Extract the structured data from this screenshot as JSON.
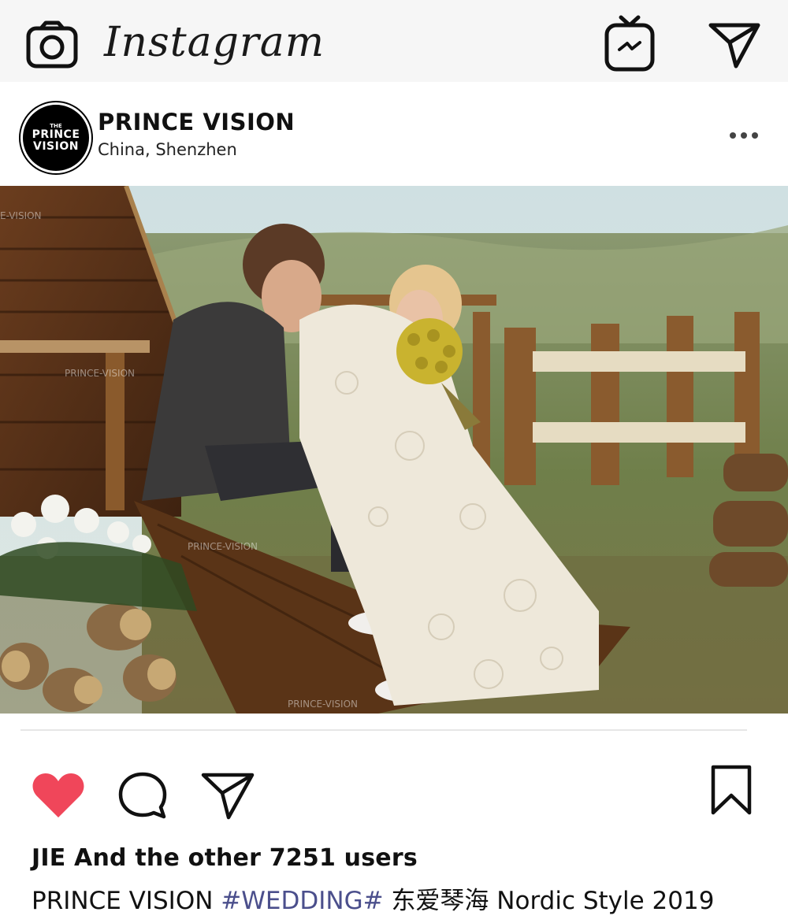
{
  "app": {
    "title": "Instagram"
  },
  "post": {
    "username": "PRINCE VISION",
    "location": "China, Shenzhen",
    "avatar": {
      "line1": "THE",
      "line2": "PRINCE",
      "line3": "VISION"
    },
    "photo": {
      "watermark": "PRINCE VISION"
    },
    "likes_text": "JIE And the other 7251 users",
    "caption": {
      "author": "PRINCE VISION",
      "hashtag": "#WEDDING#",
      "text": "东爱琴海 Nordic Style 2019"
    }
  },
  "icons": {
    "camera": "camera-icon",
    "igtv": "igtv-icon",
    "direct": "send-icon",
    "more": "more-options-icon",
    "like": "heart-icon",
    "comment": "comment-icon",
    "share": "share-icon",
    "save": "bookmark-icon"
  },
  "colors": {
    "like_red": "#f0465a",
    "hashtag": "#4b4f8c",
    "topbar_bg": "#f6f6f6"
  }
}
